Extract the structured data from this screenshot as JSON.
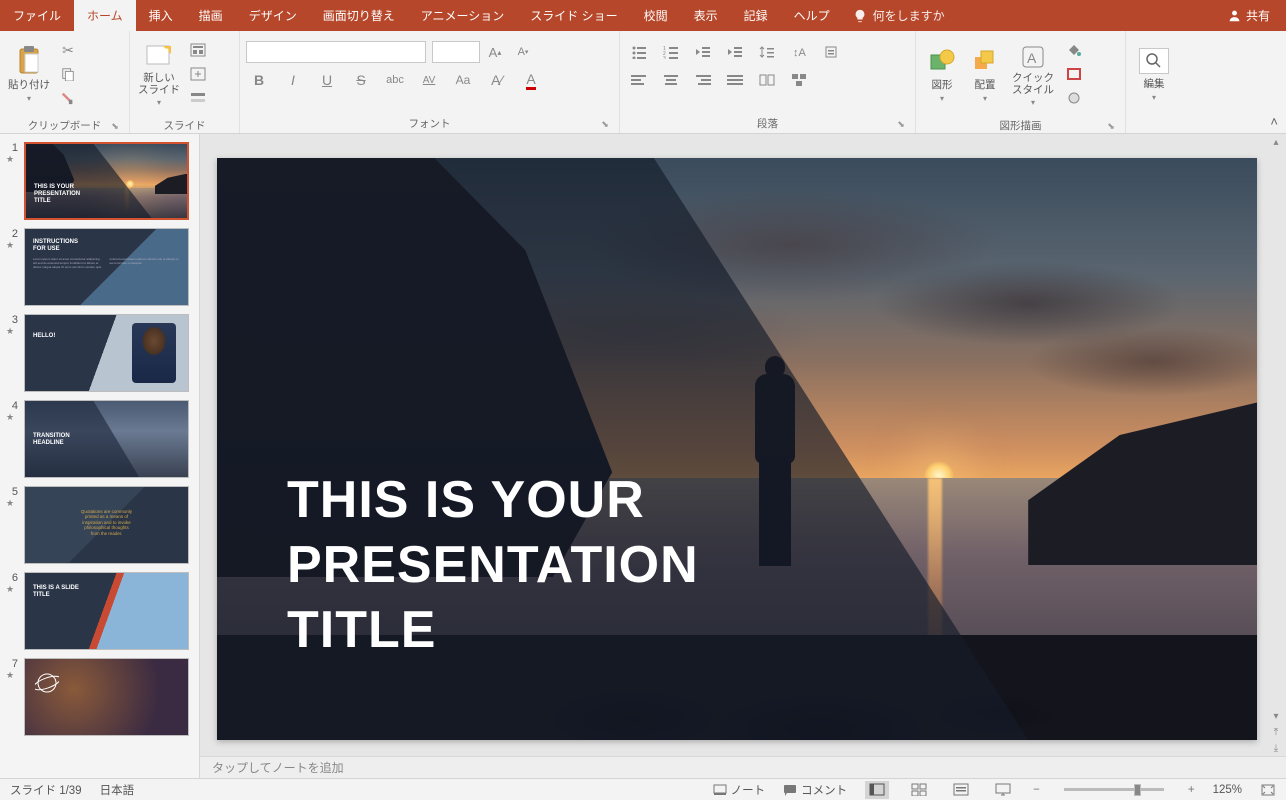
{
  "tabs": [
    "ファイル",
    "ホーム",
    "挿入",
    "描画",
    "デザイン",
    "画面切り替え",
    "アニメーション",
    "スライド ショー",
    "校閲",
    "表示",
    "記録",
    "ヘルプ"
  ],
  "active_tab": 1,
  "tellme": "何をしますか",
  "share": "共有",
  "ribbon": {
    "clipboard": {
      "label": "クリップボード",
      "paste": "貼り付け"
    },
    "slides": {
      "label": "スライド",
      "newslide": "新しい\nスライド"
    },
    "font": {
      "label": "フォント"
    },
    "paragraph": {
      "label": "段落"
    },
    "drawing": {
      "label": "図形描画",
      "shapes": "図形",
      "arrange": "配置",
      "quickstyles": "クイック\nスタイル"
    },
    "editing": {
      "label": "編集"
    }
  },
  "thumbnails": [
    {
      "num": "1",
      "title": "THIS IS YOUR\nPRESENTATION\nTITLE",
      "selected": true
    },
    {
      "num": "2",
      "title": "INSTRUCTIONS\nFOR USE"
    },
    {
      "num": "3",
      "title": "HELLO!"
    },
    {
      "num": "4",
      "title": "TRANSITION\nHEADLINE"
    },
    {
      "num": "5",
      "title": "Quotations are commonly\nprinted as a means of\ninspiration and to invoke\nphilosophical thoughts\nfrom the reader."
    },
    {
      "num": "6",
      "title": "THIS IS A SLIDE\nTITLE"
    },
    {
      "num": "7",
      "title": ""
    }
  ],
  "slide_title": "THIS IS YOUR\nPRESENTATION\nTITLE",
  "notes_placeholder": "タップしてノートを追加",
  "status": {
    "slidecount": "スライド 1/39",
    "language": "日本語",
    "notes": "ノート",
    "comments": "コメント",
    "zoom": "125%"
  }
}
